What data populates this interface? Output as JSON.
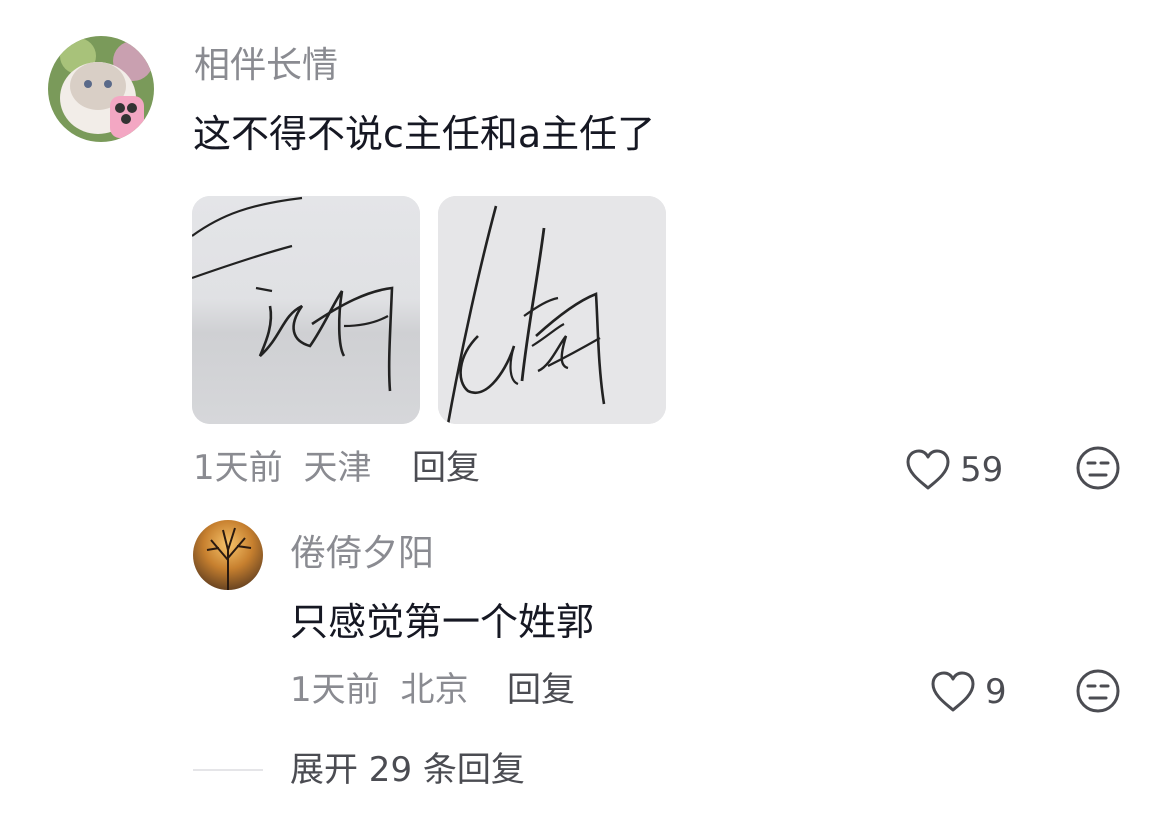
{
  "comment": {
    "username": "相伴长情",
    "text": "这不得不说c主任和a主任了",
    "time": "1天前",
    "location": "天津",
    "reply_label": "回复",
    "like_count": "59",
    "images": [
      "signature-image-1",
      "signature-image-2"
    ]
  },
  "reply": {
    "username": "倦倚夕阳",
    "text": "只感觉第一个姓郭",
    "time": "1天前",
    "location": "北京",
    "reply_label": "回复",
    "like_count": "9"
  },
  "expand_label": "展开 29 条回复",
  "icons": {
    "like": "heart-outline-icon",
    "dislike": "neutral-face-icon"
  },
  "colors": {
    "primary_text": "#161823",
    "secondary_text": "#8a8b91",
    "action_text": "#4b4c52"
  }
}
